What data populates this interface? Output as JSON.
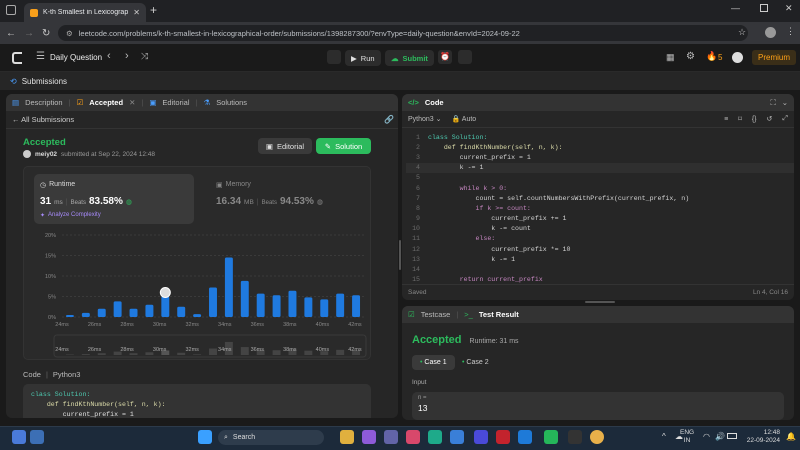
{
  "browser": {
    "tab_title": "K-th Smallest in Lexicographica...",
    "url": "leetcode.com/problems/k-th-smallest-in-lexicographical-order/submissions/1398287300/?envType=daily-question&envId=2024-09-22"
  },
  "nav": {
    "daily": "Daily Question",
    "run": "Run",
    "submit": "Submit",
    "streak": "5",
    "premium": "Premium"
  },
  "subbar": {
    "label": "Submissions"
  },
  "left_tabs": {
    "description": "Description",
    "accepted": "Accepted",
    "editorial": "Editorial",
    "solutions": "Solutions"
  },
  "all_submissions": "All Submissions",
  "result": {
    "status": "Accepted",
    "user": "meiy02",
    "submitted": "submitted at Sep 22, 2024 12:48",
    "editorial_btn": "Editorial",
    "solution_btn": "Solution"
  },
  "runtime": {
    "label": "Runtime",
    "value": "31",
    "unit": "ms",
    "beats_label": "Beats",
    "beats": "83.58%",
    "analyze": "Analyze Complexity"
  },
  "memory": {
    "label": "Memory",
    "value": "16.34",
    "unit": "MB",
    "beats_label": "Beats",
    "beats": "94.53%"
  },
  "chart_data": {
    "type": "bar",
    "ylabels": [
      "20%",
      "15%",
      "10%",
      "5%",
      "0%"
    ],
    "ylim": [
      0,
      20
    ],
    "xlabels": [
      "24ms",
      "26ms",
      "28ms",
      "30ms",
      "32ms",
      "34ms",
      "36ms",
      "38ms",
      "40ms",
      "42ms"
    ],
    "values": [
      0.5,
      1,
      2,
      3.8,
      2,
      3,
      5,
      2.5,
      0.7,
      7.2,
      14.5,
      8.8,
      5.7,
      5.3,
      6.4,
      4.8,
      4.3,
      5.7,
      5.3
    ],
    "highlight_index": 6,
    "range_labels": [
      "24ms",
      "26ms",
      "28ms",
      "30ms",
      "32ms",
      "34ms",
      "36ms",
      "38ms",
      "40ms",
      "42ms"
    ]
  },
  "code_label": {
    "code": "Code",
    "lang": "Python3"
  },
  "bottom_code": [
    "class Solution:",
    "    def findKthNumber(self, n, k):",
    "        current_prefix = 1"
  ],
  "editor": {
    "title": "Code",
    "lang": "Python3",
    "auto": "Auto",
    "saved": "Saved",
    "position": "Ln 4, Col 16",
    "lines": [
      {
        "n": "1",
        "t": "class Solution:"
      },
      {
        "n": "2",
        "t": "    def findKthNumber(self, n, k):"
      },
      {
        "n": "3",
        "t": "        current_prefix = 1"
      },
      {
        "n": "4",
        "t": "        k -= 1"
      },
      {
        "n": "5",
        "t": ""
      },
      {
        "n": "6",
        "t": "        while k > 0:"
      },
      {
        "n": "7",
        "t": "            count = self.countNumbersWithPrefix(current_prefix, n)"
      },
      {
        "n": "8",
        "t": "            if k >= count:"
      },
      {
        "n": "9",
        "t": "                current_prefix += 1"
      },
      {
        "n": "10",
        "t": "                k -= count"
      },
      {
        "n": "11",
        "t": "            else:"
      },
      {
        "n": "12",
        "t": "                current_prefix *= 10"
      },
      {
        "n": "13",
        "t": "                k -= 1"
      },
      {
        "n": "14",
        "t": ""
      },
      {
        "n": "15",
        "t": "        return current_prefix"
      }
    ]
  },
  "test": {
    "testcase_tab": "Testcase",
    "result_tab": "Test Result",
    "status": "Accepted",
    "runtime": "Runtime: 31 ms",
    "case1": "Case 1",
    "case2": "Case 2",
    "input_label": "Input",
    "var_name": "n =",
    "var_value": "13"
  },
  "taskbar": {
    "search": "Search",
    "lang": "ENG",
    "region": "IN",
    "time": "12:48",
    "date": "22-09-2024"
  }
}
